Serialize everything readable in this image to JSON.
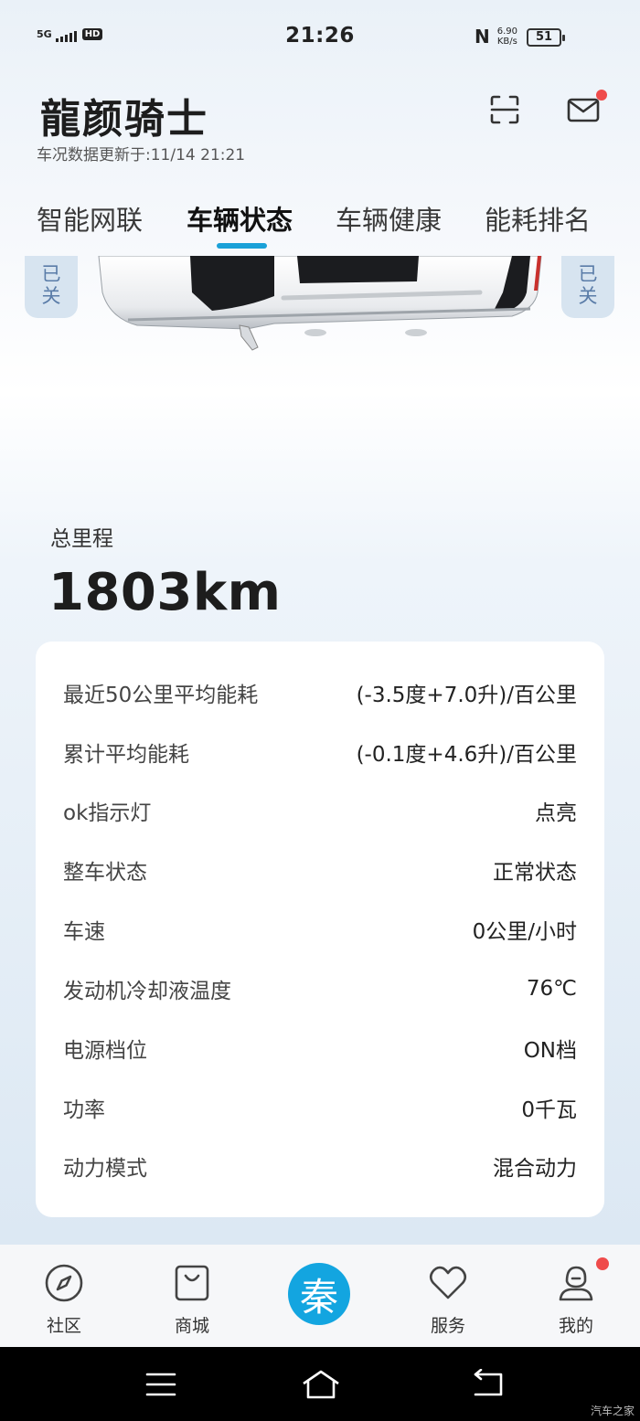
{
  "status_bar": {
    "network": "5G",
    "hd": "HD",
    "time": "21:26",
    "speed_value": "6.90",
    "speed_unit": "KB/s",
    "battery": "51"
  },
  "header": {
    "title": "龍颜骑士",
    "subtitle": "车况数据更新于:11/14 21:21"
  },
  "tabs": [
    {
      "label": "智能网联",
      "active": false
    },
    {
      "label": "车辆状态",
      "active": true
    },
    {
      "label": "车辆健康",
      "active": false
    },
    {
      "label": "能耗排名",
      "active": false
    }
  ],
  "side_chips": {
    "left": "已\n关",
    "right": "已\n关"
  },
  "mileage": {
    "label": "总里程",
    "value": "1803km"
  },
  "status_rows": [
    {
      "label": "最近50公里平均能耗",
      "value": "(-3.5度+7.0升)/百公里"
    },
    {
      "label": "累计平均能耗",
      "value": "(-0.1度+4.6升)/百公里"
    },
    {
      "label": "ok指示灯",
      "value": "点亮"
    },
    {
      "label": "整车状态",
      "value": "正常状态"
    },
    {
      "label": "车速",
      "value": "0公里/小时"
    },
    {
      "label": "发动机冷却液温度",
      "value": "76℃"
    },
    {
      "label": "电源档位",
      "value": "ON档"
    },
    {
      "label": "功率",
      "value": "0千瓦"
    },
    {
      "label": "动力模式",
      "value": "混合动力"
    }
  ],
  "bottom_nav": {
    "community": "社区",
    "mall": "商城",
    "center": "秦",
    "service": "服务",
    "mine": "我的"
  },
  "watermark": "汽车之家",
  "colors": {
    "accent": "#13a5e0",
    "badge": "#ef4b4b",
    "chip_bg": "#d7e4f0",
    "chip_text": "#5a7ca8"
  }
}
